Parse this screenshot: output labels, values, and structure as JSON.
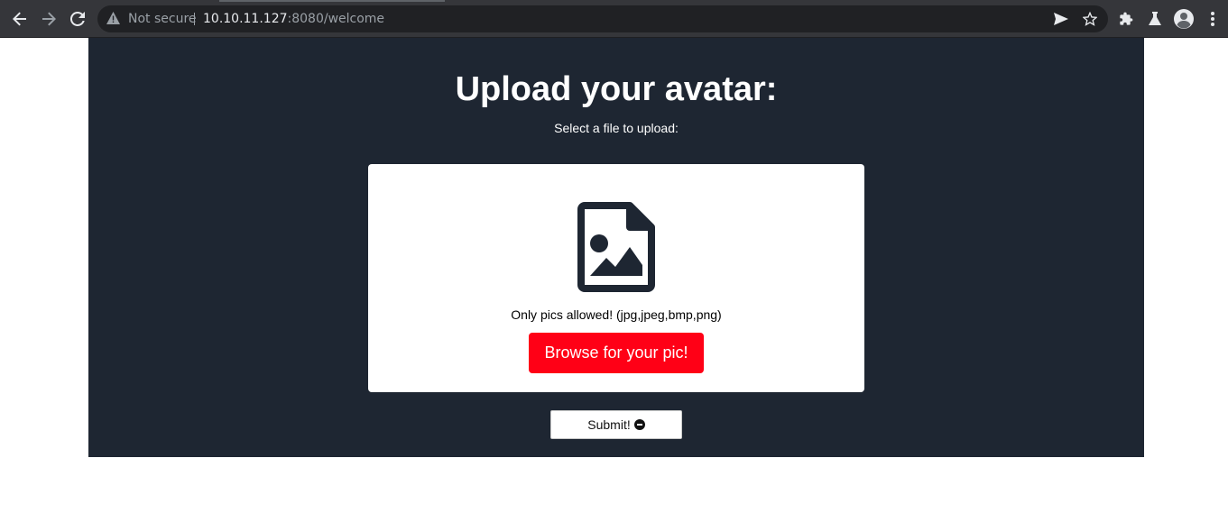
{
  "browser": {
    "security_label": "Not secure",
    "url_host": "10.10.11.127",
    "url_rest": ":8080/welcome",
    "icons": {
      "back": "back-arrow-icon",
      "forward": "forward-arrow-icon",
      "reload": "reload-icon",
      "warning": "warning-triangle-icon",
      "send": "send-icon",
      "bookmark": "star-icon",
      "extensions": "puzzle-icon",
      "labs": "flask-icon",
      "profile": "avatar-icon",
      "menu": "kebab-menu-icon"
    }
  },
  "page": {
    "title": "Upload your avatar:",
    "subtitle": "Select a file to upload:",
    "upload_card": {
      "icon": "image-file-icon",
      "allowed_text": "Only pics allowed! (jpg,jpeg,bmp,png)",
      "browse_label": "Browse for your pic!"
    },
    "submit_label": "Submit!",
    "submit_icon": "minus-circle-icon"
  },
  "colors": {
    "page_background": "#1e2632",
    "browse_button": "#ff0016",
    "toolbar": "#35363a"
  }
}
